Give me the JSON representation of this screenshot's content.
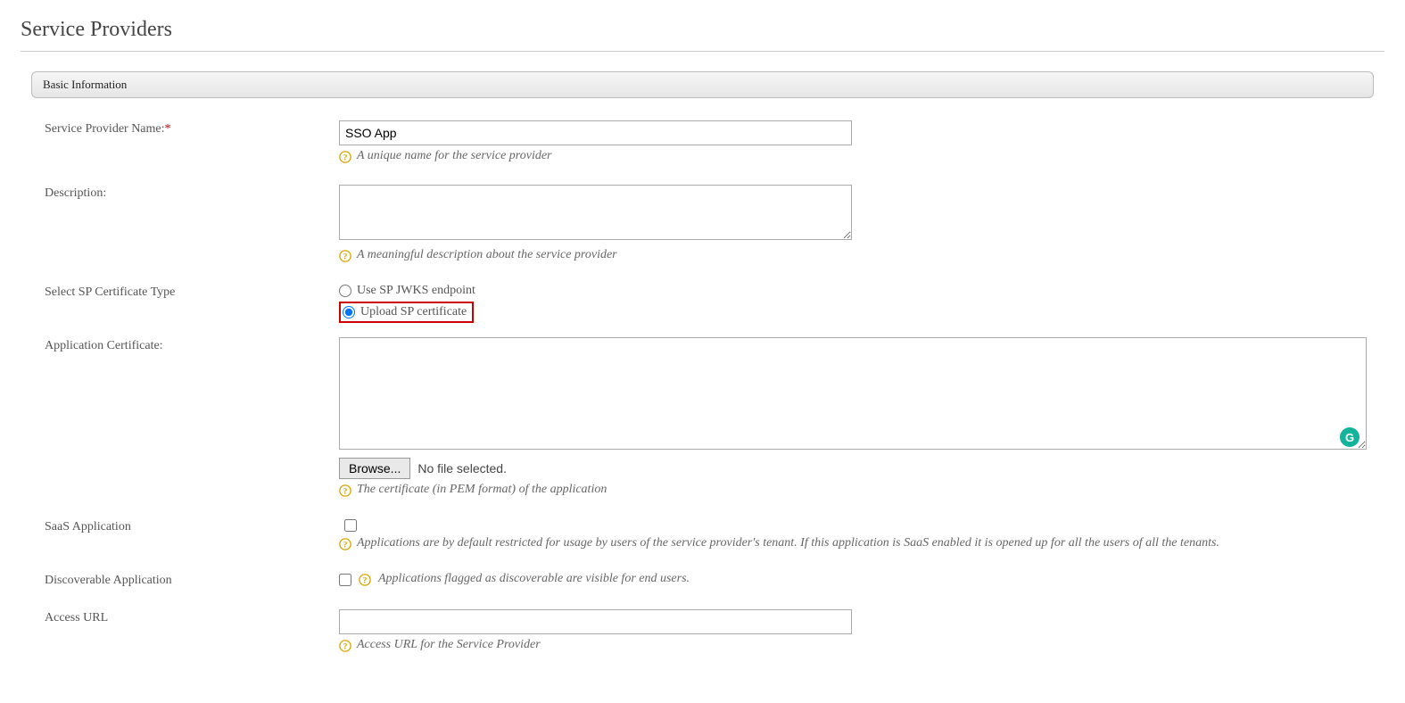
{
  "page": {
    "title": "Service Providers"
  },
  "section": {
    "header": "Basic Information"
  },
  "labels": {
    "sp_name": "Service Provider Name:",
    "description": "Description:",
    "cert_type": "Select SP Certificate Type",
    "app_cert": "Application Certificate:",
    "saas": "SaaS Application",
    "discoverable": "Discoverable Application",
    "access_url": "Access URL"
  },
  "values": {
    "sp_name": "SSO App",
    "description": "",
    "app_cert": "",
    "access_url": ""
  },
  "radios": {
    "jwks": "Use SP JWKS endpoint",
    "upload": "Upload SP certificate"
  },
  "browse": {
    "button": "Browse...",
    "no_file": "No file selected."
  },
  "help": {
    "sp_name": "A unique name for the service provider",
    "description": "A meaningful description about the service provider",
    "app_cert": "The certificate (in PEM format) of the application",
    "saas": "Applications are by default restricted for usage by users of the service provider's tenant. If this application is SaaS enabled it is opened up for all the users of all the tenants.",
    "discoverable": "Applications flagged as discoverable are visible for end users.",
    "access_url": "Access URL for the Service Provider"
  },
  "badge": {
    "g": "G"
  }
}
